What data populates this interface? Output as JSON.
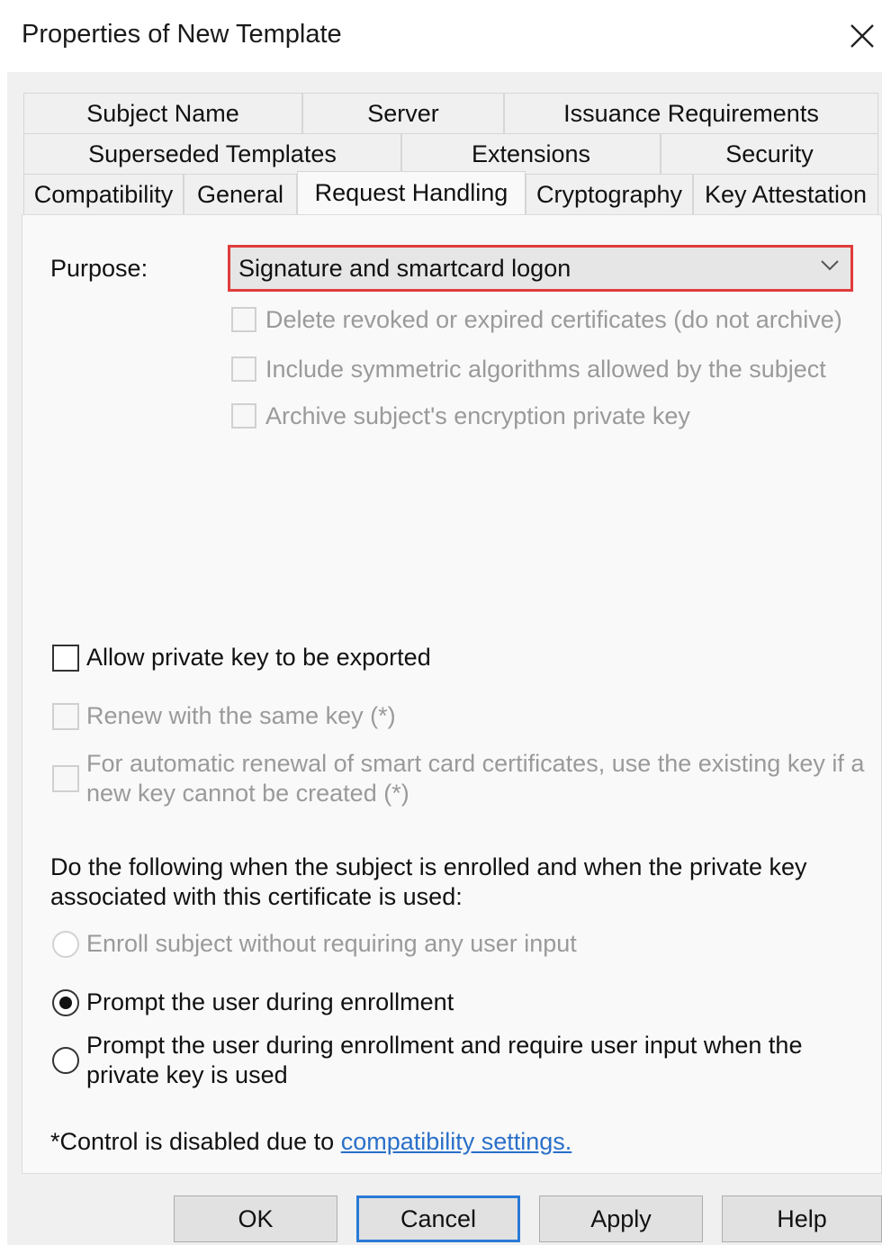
{
  "window": {
    "title": "Properties of New Template"
  },
  "tabs": {
    "row1": [
      "Subject Name",
      "Server",
      "Issuance Requirements"
    ],
    "row2": [
      "Superseded Templates",
      "Extensions",
      "Security"
    ],
    "row3": [
      "Compatibility",
      "General",
      "Request Handling",
      "Cryptography",
      "Key Attestation"
    ],
    "active": "Request Handling"
  },
  "request_handling": {
    "purpose_label": "Purpose:",
    "purpose_value": "Signature and smartcard logon",
    "purpose_options": [
      {
        "label": "Delete revoked or expired certificates (do not archive)",
        "checked": false,
        "enabled": false
      },
      {
        "label": "Include symmetric algorithms allowed by the subject",
        "checked": false,
        "enabled": false
      },
      {
        "label": "Archive subject's encryption private key",
        "checked": false,
        "enabled": false
      }
    ],
    "allow_export": {
      "label": "Allow private key to be exported",
      "checked": false,
      "enabled": true
    },
    "renew_same_key": {
      "label": "Renew with the same key (*)",
      "checked": false,
      "enabled": false
    },
    "auto_renewal": {
      "line1": "For automatic renewal of smart card certificates, use the existing key if a",
      "line2": "new key cannot be created (*)",
      "checked": false,
      "enabled": false
    },
    "enroll_question_line1": "Do the following when the subject is enrolled and when the private key",
    "enroll_question_line2": "associated with this certificate is used:",
    "enroll_options": [
      {
        "line1": "Enroll subject without requiring any user input",
        "line2": "",
        "selected": false,
        "enabled": false
      },
      {
        "line1": "Prompt the user during enrollment",
        "line2": "",
        "selected": true,
        "enabled": true
      },
      {
        "line1": "Prompt the user during enrollment and require user input when the",
        "line2": "private key is used",
        "selected": false,
        "enabled": true
      }
    ],
    "footnote_prefix": "*Control is disabled due to ",
    "footnote_link": "compatibility settings."
  },
  "buttons": {
    "ok": "OK",
    "cancel": "Cancel",
    "apply": "Apply",
    "help": "Help"
  }
}
